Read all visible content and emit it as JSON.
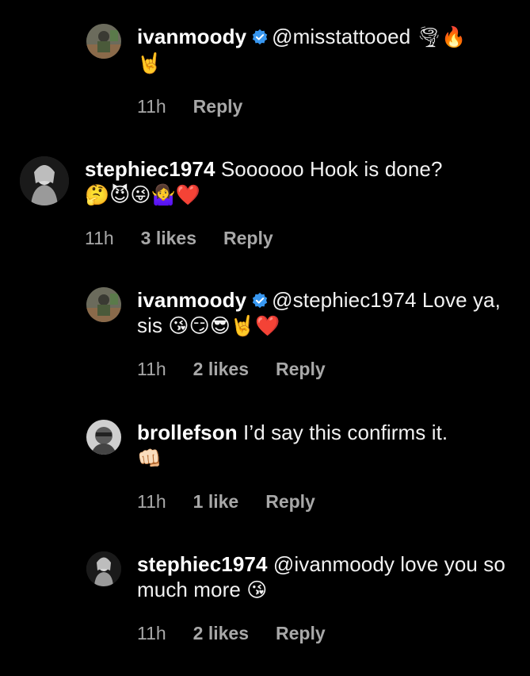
{
  "comments": [
    {
      "username": "ivanmoody",
      "verified": true,
      "text": "@misstattooed",
      "emojis": "🌪🔥\n🤘",
      "time": "11h",
      "likes": "",
      "reply": "Reply"
    },
    {
      "username": "stephiec1974",
      "verified": false,
      "text": "Soooooo Hook is done?",
      "emojis": "🤔😈😜🤷‍♀️❤️",
      "time": "11h",
      "likes": "3 likes",
      "reply": "Reply"
    },
    {
      "username": "ivanmoody",
      "verified": true,
      "text": "@stephiec1974 Love ya, sis",
      "emojis": "😘😏😎🤘❤️",
      "time": "11h",
      "likes": "2 likes",
      "reply": "Reply"
    },
    {
      "username": "brollefson",
      "verified": false,
      "text": "I’d say this confirms it.",
      "emojis": "👊🏻",
      "time": "11h",
      "likes": "1 like",
      "reply": "Reply"
    },
    {
      "username": "stephiec1974",
      "verified": false,
      "text": "@ivanmoody love you so much more",
      "emojis": "😘",
      "time": "11h",
      "likes": "2 likes",
      "reply": "Reply"
    }
  ],
  "colors": {
    "background": "#000000",
    "text": "#f2f2f2",
    "meta": "#a8a8a8",
    "verified_badge": "#3897f0"
  }
}
